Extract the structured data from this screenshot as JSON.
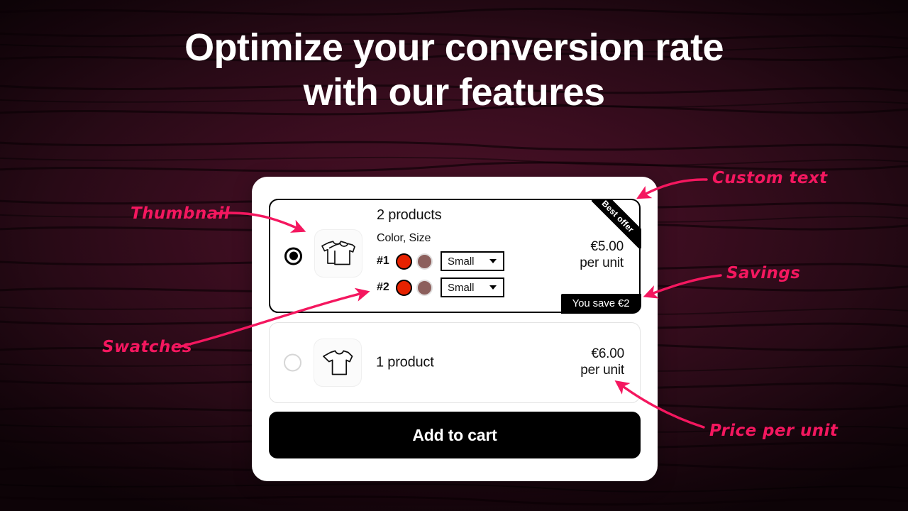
{
  "headline": {
    "line1": "Optimize your conversion rate",
    "line2": "with our features"
  },
  "colors": {
    "background": "#2a0e1a",
    "background_center": "#4d1229",
    "annotation_pink": "#f4175f",
    "panel": "#ffffff",
    "black": "#000000",
    "swatch_selected": "#e62200",
    "swatch_unselected": "#8c5f5c"
  },
  "offers": [
    {
      "id": "offer-2-products",
      "selected": true,
      "radio_state": "selected",
      "thumbnail_icon": "stacked-tshirts-icon",
      "title": "2 products",
      "options_label": "Color, Size",
      "variants": [
        {
          "number": "#1",
          "swatches": [
            {
              "name": "swatch-red",
              "color": "#e62200",
              "selected": true
            },
            {
              "name": "swatch-mauve",
              "color": "#8c5f5c",
              "selected": false
            }
          ],
          "size_value": "Small"
        },
        {
          "number": "#2",
          "swatches": [
            {
              "name": "swatch-red",
              "color": "#e62200",
              "selected": true
            },
            {
              "name": "swatch-mauve",
              "color": "#8c5f5c",
              "selected": false
            }
          ],
          "size_value": "Small"
        }
      ],
      "price": "€5.00",
      "price_unit": "per unit",
      "ribbon_text": "Best offer",
      "savings_text": "You save €2"
    },
    {
      "id": "offer-1-product",
      "selected": false,
      "radio_state": "unselected",
      "thumbnail_icon": "tshirt-icon",
      "title": "1 product",
      "price": "€6.00",
      "price_unit": "per unit"
    }
  ],
  "add_to_cart_label": "Add to cart",
  "annotations": [
    {
      "id": "anno-thumbnail",
      "text": "Thumbnail"
    },
    {
      "id": "anno-custom-text",
      "text": "Custom text"
    },
    {
      "id": "anno-savings",
      "text": "Savings"
    },
    {
      "id": "anno-swatches",
      "text": "Swatches"
    },
    {
      "id": "anno-price-per-unit",
      "text": "Price per unit"
    }
  ]
}
